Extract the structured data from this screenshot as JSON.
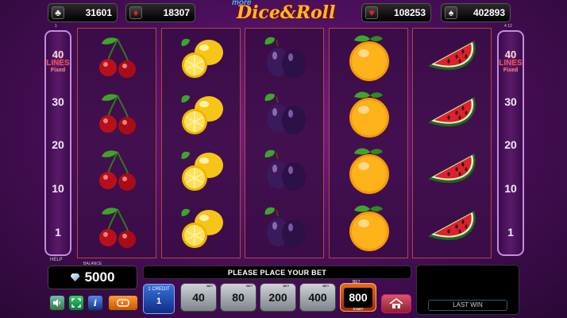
{
  "jackpots": [
    {
      "suit": "club",
      "value": "31601"
    },
    {
      "suit": "diamond",
      "value": "18307"
    },
    {
      "suit": "heart",
      "value": "108253"
    },
    {
      "suit": "spade",
      "value": "402893"
    }
  ],
  "logo": {
    "prefix": "more",
    "title": "Dice&Roll"
  },
  "left_panel": {
    "top_label": "1",
    "lines_count": "40",
    "lines_label": "LINES",
    "lines_mode": "Fixed",
    "numbers": [
      "30",
      "20",
      "10",
      "1"
    ]
  },
  "right_panel": {
    "top_label": "4 12",
    "lines_count": "40",
    "lines_label": "LINES",
    "lines_mode": "Fixed",
    "numbers": [
      "30",
      "20",
      "10",
      "1"
    ]
  },
  "reels": [
    {
      "symbol": "cherry"
    },
    {
      "symbol": "lemon"
    },
    {
      "symbol": "plum"
    },
    {
      "symbol": "orange"
    },
    {
      "symbol": "watermelon"
    }
  ],
  "bottom": {
    "help_label": "HELP",
    "balance_label": "BALANCE",
    "balance": "5000",
    "message": "PLEASE PLACE YOUR BET",
    "last_win_label": "LAST WIN",
    "credit": {
      "title": "1 CREDIT",
      "denom": "=",
      "value": "1"
    },
    "bets": [
      "40",
      "80",
      "200",
      "400"
    ],
    "bet_caps": [
      "BET",
      "BET",
      "BET",
      "BET"
    ],
    "active_bet": "800",
    "active_bet_tag": "BET",
    "active_bet_caption": "START"
  },
  "buttons": {
    "sound_icon": "speaker-icon",
    "fullscreen_icon": "fullscreen-icon",
    "info_label": "i",
    "autoplay_icon": "autoplay-icon",
    "home_icon": "home-icon"
  }
}
